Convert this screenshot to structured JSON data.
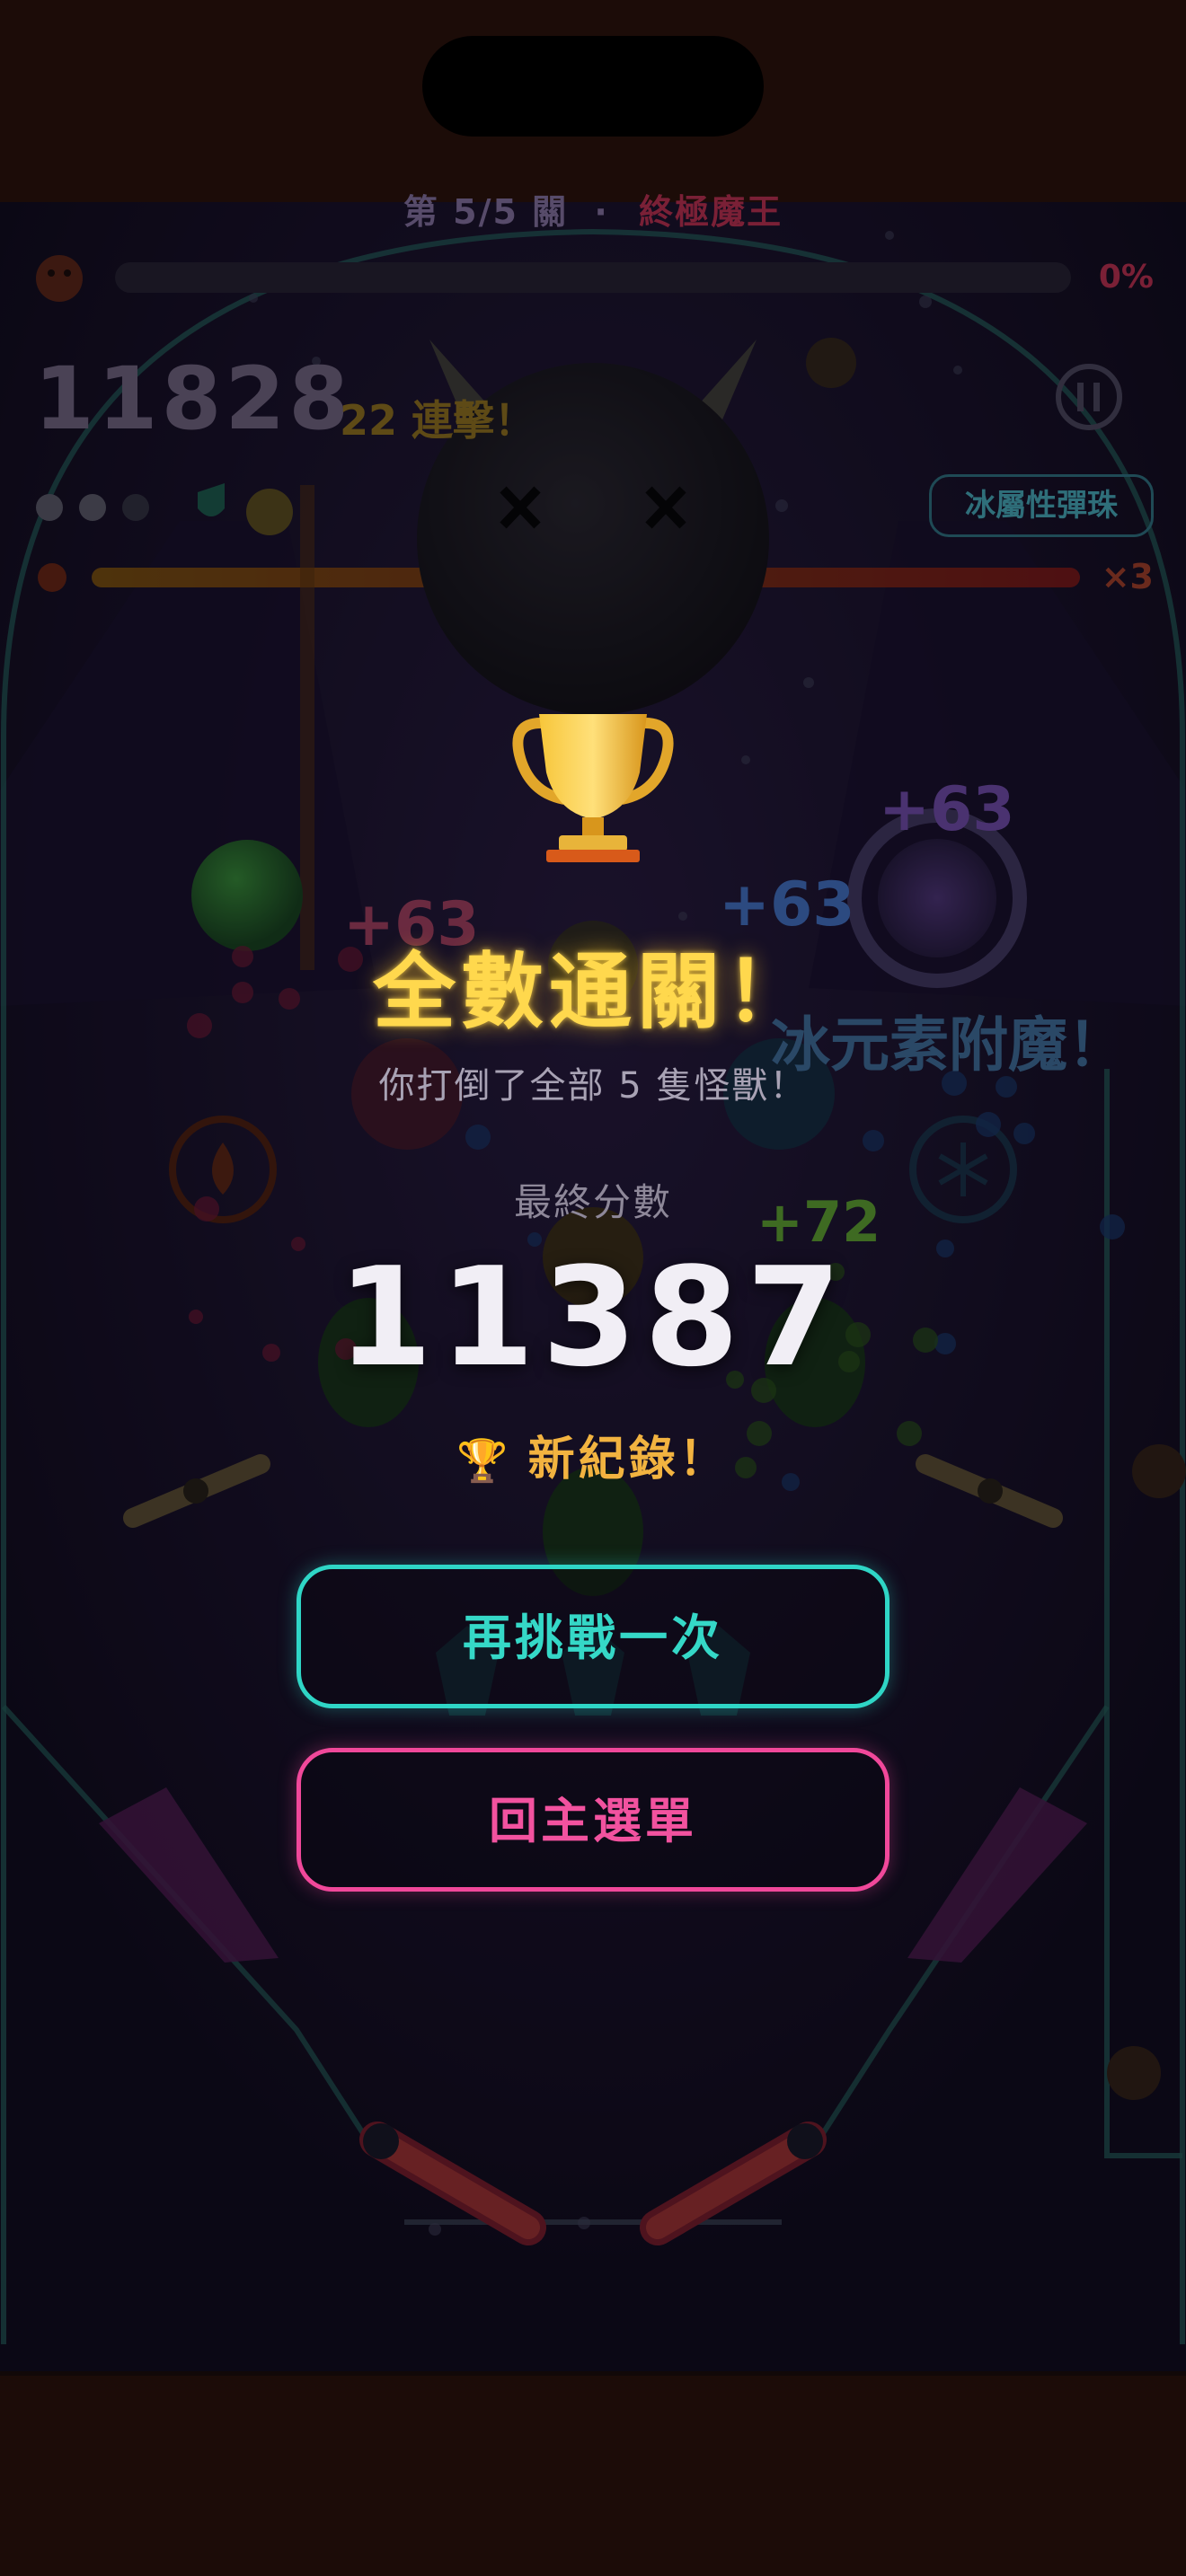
{
  "hud": {
    "level_text": "第 5/5 關",
    "separator": "·",
    "boss_name": "終極魔王",
    "boss_progress_percent": "0%",
    "score": "11828",
    "combo": "22 連擊！",
    "element_chip": "冰屬性彈珠",
    "multiplier": "×3",
    "lives_remaining": 3
  },
  "floating_text": {
    "plus_63_a": "+63",
    "plus_63_b": "+63",
    "plus_63_c": "+63",
    "plus_72": "+72",
    "enchant": "冰元素附魔！"
  },
  "overlay": {
    "trophy_emoji": "🏆",
    "title": "全數通關！",
    "subtitle": "你打倒了全部 5 隻怪獸！",
    "final_score_label": "最終分數",
    "final_score": "11387",
    "new_record_icon": "🏆",
    "new_record": "新紀錄！",
    "retry_button": "再挑戰一次",
    "menu_button": "回主選單"
  },
  "colors": {
    "title_gold": "#ffd84d",
    "retry_teal": "#2fd6c6",
    "menu_pink": "#f0489a",
    "record_orange": "#f2b340"
  }
}
